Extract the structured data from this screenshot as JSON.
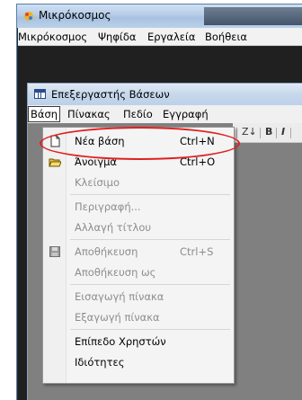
{
  "outer_window": {
    "title": "Μικρόκοσμος",
    "menu": [
      "Μικρόκοσμος",
      "Ψηφίδα",
      "Εργαλεία",
      "Βοήθεια"
    ]
  },
  "inner_window": {
    "title": "Επεξεργαστής Βάσεων",
    "menu": [
      "Βάση",
      "Πίνακας",
      "Πεδίο",
      "Εγγραφή"
    ],
    "active_menu": "Βάση",
    "toolbar": [
      "Z↓",
      "B",
      "I"
    ]
  },
  "dropdown": {
    "items": [
      {
        "label": "Νέα βάση",
        "shortcut": "Ctrl+N",
        "enabled": true,
        "icon": "new-document-icon"
      },
      {
        "label": "Άνοιγμα",
        "shortcut": "Ctrl+O",
        "enabled": true,
        "icon": "open-folder-icon"
      },
      {
        "label": "Κλείσιμο",
        "shortcut": "",
        "enabled": false
      },
      {
        "label": "Περιγραφή...",
        "shortcut": "",
        "enabled": false
      },
      {
        "label": "Αλλαγή τίτλου",
        "shortcut": "",
        "enabled": false
      },
      {
        "label": "Αποθήκευση",
        "shortcut": "Ctrl+S",
        "enabled": false,
        "icon": "save-disk-icon"
      },
      {
        "label": "Αποθήκευση ως",
        "shortcut": "",
        "enabled": false
      },
      {
        "label": "Εισαγωγή πίνακα",
        "shortcut": "",
        "enabled": false
      },
      {
        "label": "Εξαγωγή πίνακα",
        "shortcut": "",
        "enabled": false
      },
      {
        "label": "Επίπεδο Χρηστών",
        "shortcut": "",
        "enabled": true
      },
      {
        "label": "Ιδιότητες",
        "shortcut": "",
        "enabled": true
      }
    ]
  },
  "colors": {
    "highlight": "#e02020",
    "disabled_text": "#8d8d8d"
  }
}
